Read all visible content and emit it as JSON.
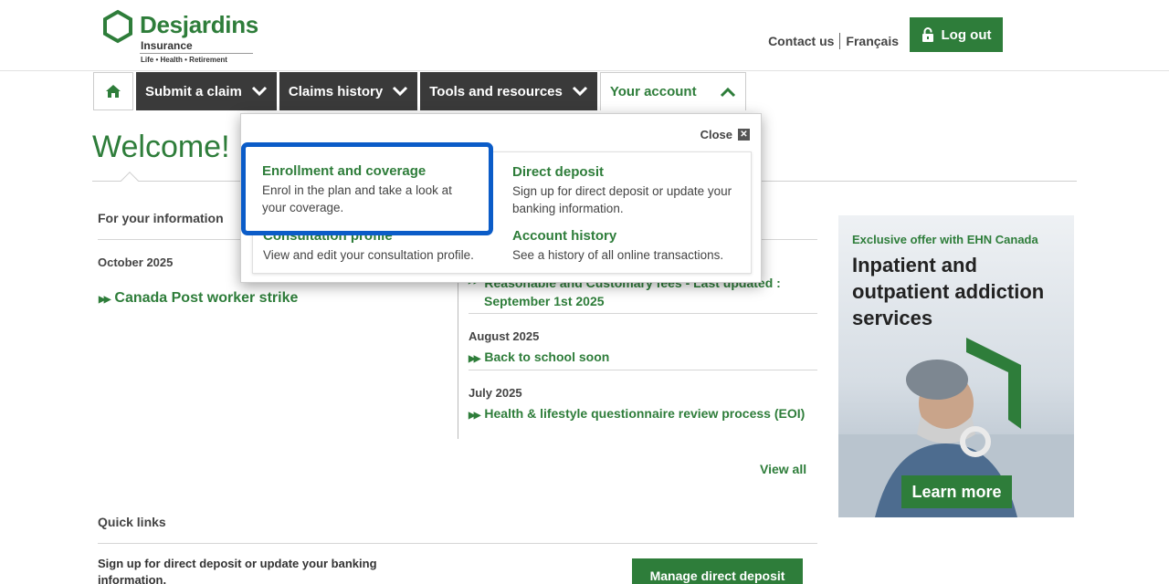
{
  "header": {
    "brand": "Desjardins",
    "brand_sub1": "Insurance",
    "brand_sub2": "Life • Health • Retirement",
    "contact_label": "Contact us",
    "language_label": "Français",
    "logout_label": "Log out"
  },
  "nav": {
    "items": [
      {
        "label": "Submit a claim"
      },
      {
        "label": "Claims history"
      },
      {
        "label": "Tools and resources"
      },
      {
        "label": "Your account"
      }
    ]
  },
  "page": {
    "welcome": "Welcome!",
    "for_your_info": "For your information",
    "left_news": {
      "month": "October 2025",
      "link": "Canada Post worker strike"
    },
    "right_news": [
      {
        "month": "",
        "link_line1": "Reasonable and Customary fees - Last updated :",
        "link_line2": "September 1st 2025"
      },
      {
        "month": "August 2025",
        "link_line1": "Back to school soon"
      },
      {
        "month": "July 2025",
        "link_line1": "Health & lifestyle questionnaire review process (EOI)"
      }
    ],
    "view_all": "View all",
    "quick_links_title": "Quick links",
    "quick_text": "Sign up for direct deposit or update your banking information.",
    "manage_button": "Manage direct deposit"
  },
  "ad": {
    "kicker": "Exclusive offer with EHN Canada",
    "headline": "Inpatient and outpatient addiction services",
    "cta": "Learn more"
  },
  "dropdown": {
    "close_label": "Close",
    "close_glyph": "✕",
    "items": [
      {
        "title": "Enrollment and coverage",
        "desc": "Enrol in the plan and take a look at your coverage."
      },
      {
        "title": "Direct deposit",
        "desc": "Sign up for direct deposit or update your banking information."
      },
      {
        "title": "Consultation profile",
        "desc": "View and edit your consultation profile."
      },
      {
        "title": "Account history",
        "desc": "See a history of all online transactions."
      }
    ]
  },
  "colors": {
    "brand_green": "#2e7d3a",
    "nav_dark": "#3a3a3a",
    "highlight_blue": "#0b5cc8"
  },
  "icons": {
    "home": "home-icon",
    "chevron": "chevron-down-icon",
    "lock": "lock-icon",
    "close": "close-icon"
  }
}
